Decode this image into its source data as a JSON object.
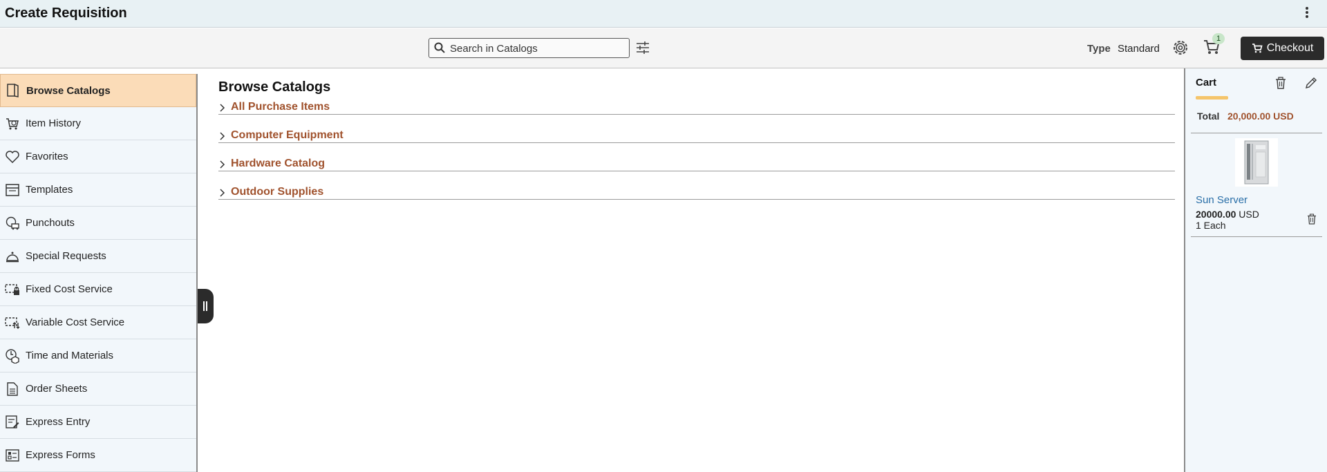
{
  "app": {
    "title": "Create Requisition"
  },
  "toolbar": {
    "search_placeholder": "Search in Catalogs",
    "type_label": "Type",
    "type_value": "Standard",
    "cart_count": "1",
    "checkout_label": "Checkout"
  },
  "sidebar": {
    "items": [
      {
        "label": "Browse Catalogs",
        "icon": "book-icon",
        "active": true
      },
      {
        "label": "Item History",
        "icon": "history-cart-icon"
      },
      {
        "label": "Favorites",
        "icon": "heart-icon"
      },
      {
        "label": "Templates",
        "icon": "template-icon"
      },
      {
        "label": "Punchouts",
        "icon": "punchout-icon"
      },
      {
        "label": "Special Requests",
        "icon": "bell-icon"
      },
      {
        "label": "Fixed Cost Service",
        "icon": "fixed-cost-icon"
      },
      {
        "label": "Variable Cost Service",
        "icon": "variable-cost-icon"
      },
      {
        "label": "Time and Materials",
        "icon": "time-materials-icon"
      },
      {
        "label": "Order Sheets",
        "icon": "document-icon"
      },
      {
        "label": "Express Entry",
        "icon": "express-entry-icon"
      },
      {
        "label": "Express Forms",
        "icon": "form-icon"
      }
    ]
  },
  "main": {
    "heading": "Browse Catalogs",
    "categories": [
      "All Purchase Items",
      "Computer Equipment",
      "Hardware Catalog",
      "Outdoor Supplies"
    ]
  },
  "cart": {
    "title": "Cart",
    "total_label": "Total",
    "total_value": "20,000.00 USD",
    "items": [
      {
        "name": "Sun Server",
        "price": "20000.00",
        "currency": "USD",
        "qty": "1 Each"
      }
    ]
  },
  "colors": {
    "accent_brown": "#a0522d",
    "active_bg": "#fbdcb8",
    "link_blue": "#2a6fa8",
    "cart_underline": "#f5c56b"
  }
}
